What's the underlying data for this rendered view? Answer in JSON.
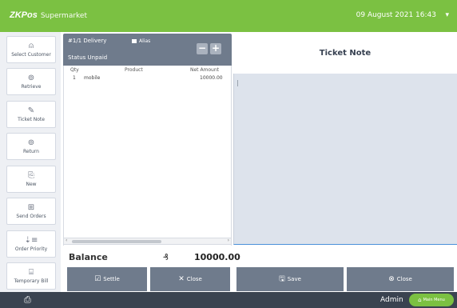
{
  "topbar": {
    "brand_logo": "ZKPos",
    "brand_name": "Supermarket",
    "datetime": "09 August 2021 16:43",
    "caret": "▾",
    "accent_color": "#7bc142"
  },
  "sidebar": {
    "items": [
      {
        "label": "Select Customer",
        "icon": "person-icon",
        "glyph": "⍝"
      },
      {
        "label": "Retrieve",
        "icon": "retrieve-icon",
        "glyph": "⊚"
      },
      {
        "label": "Ticket Note",
        "icon": "pencil-icon",
        "glyph": "✎"
      },
      {
        "label": "Return",
        "icon": "return-icon",
        "glyph": "⊚"
      },
      {
        "label": "New",
        "icon": "new-document-icon",
        "glyph": "⎘"
      },
      {
        "label": "Send Orders",
        "icon": "send-icon",
        "glyph": "⊞"
      },
      {
        "label": "Order Priority",
        "icon": "priority-icon",
        "glyph": "⇣≡"
      },
      {
        "label": "Temporary Bill",
        "icon": "bill-icon",
        "glyph": "⌸"
      }
    ]
  },
  "order": {
    "title": "#1/1 Delivery",
    "alias_label": "Alias",
    "status_label": "Status",
    "status_value": "Unpaid",
    "minus": "−",
    "plus": "+",
    "columns": {
      "qty": "Qty",
      "product": "Product",
      "net_amount": "Net Amount"
    },
    "rows": [
      {
        "qty": "1",
        "product": "mobile",
        "net_amount": "10000.00"
      }
    ],
    "scroll_left": "‹",
    "scroll_right": "›",
    "balance_label": "Balance",
    "balance_currency_icon": "₰",
    "balance_value": "10000.00",
    "header_color": "#6f7b8c"
  },
  "ticket_note": {
    "title": "Ticket Note",
    "area_color": "#dde3ec"
  },
  "actions": {
    "settle": {
      "label": "Settle",
      "glyph": "☑"
    },
    "close_order": {
      "label": "Close",
      "glyph": "✕"
    },
    "save": {
      "label": "Save",
      "glyph": "🖫"
    },
    "close_note": {
      "label": "Close",
      "glyph": "⊗"
    }
  },
  "bottombar": {
    "printer_glyph": "⎙",
    "user": "Admin",
    "main_menu": "Main Menu",
    "home_glyph": "⌂"
  }
}
